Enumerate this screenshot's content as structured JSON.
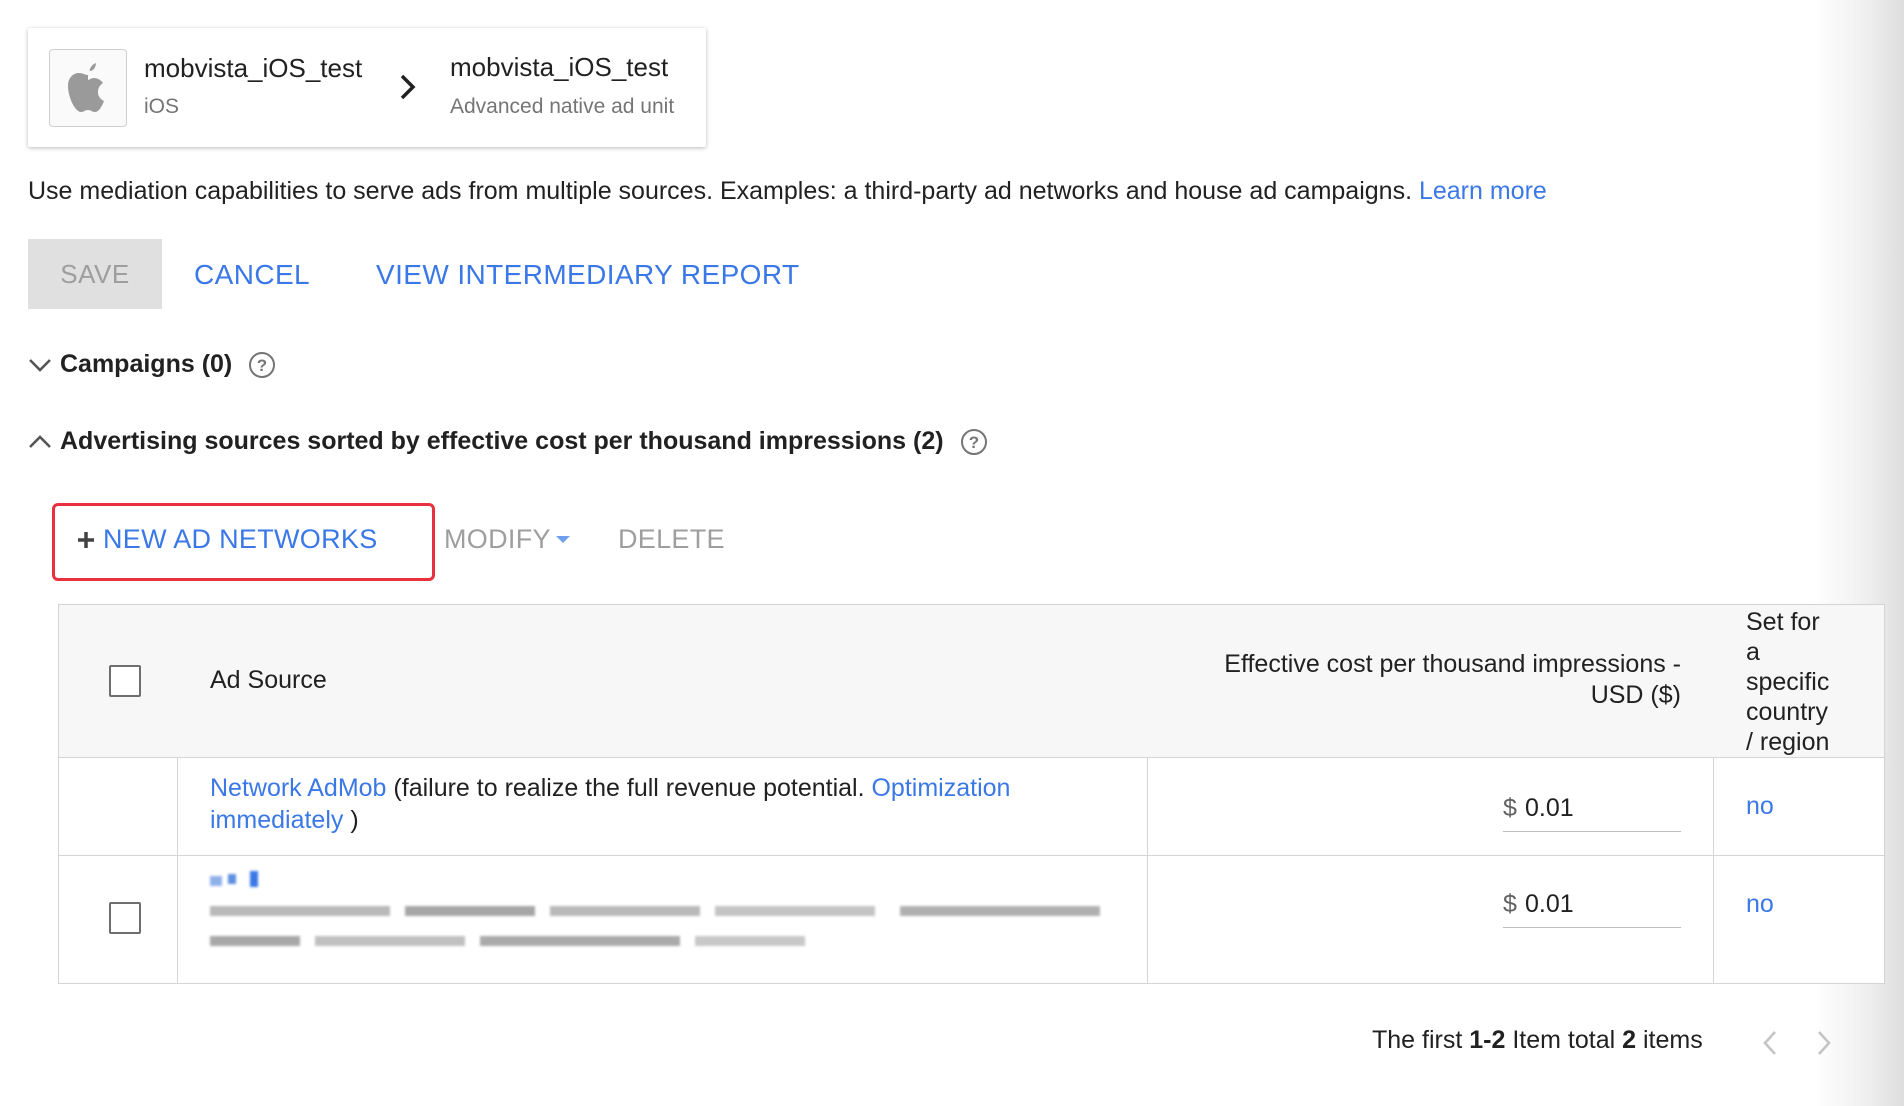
{
  "header": {
    "app_name": "mobvista_iOS_test",
    "platform": "iOS",
    "ad_unit_name": "mobvista_iOS_test",
    "ad_unit_type": "Advanced native ad unit"
  },
  "description": {
    "text": "Use mediation capabilities to serve ads from multiple sources. Examples: a third-party ad networks and house ad campaigns.",
    "learn_more": "Learn more"
  },
  "actions": {
    "save": "SAVE",
    "cancel": "CANCEL",
    "view_report": "VIEW INTERMEDIARY REPORT"
  },
  "sections": {
    "campaigns": "Campaigns (0)",
    "ad_sources": "Advertising sources sorted by effective cost per thousand impressions (2)"
  },
  "toolbar": {
    "new_ad_networks": "NEW AD NETWORKS",
    "modify": "MODIFY",
    "delete": "DELETE"
  },
  "table": {
    "columns": {
      "ad_source": "Ad Source",
      "ecpm_line1": "Effective cost per thousand impressions -",
      "ecpm_line2": "USD ($)",
      "country": [
        "Set for",
        "a",
        "specific",
        "country",
        "/ region"
      ]
    },
    "rows": [
      {
        "network_link": "Network AdMob",
        "note": "(failure to realize the full revenue potential.",
        "optimize_link_1": "Optimization",
        "optimize_link_2": "immediately",
        "close_paren": ")",
        "currency": "$",
        "ecpm": "0.01",
        "country": "no"
      },
      {
        "currency": "$",
        "ecpm": "0.01",
        "country": "no"
      }
    ]
  },
  "pagination": {
    "prefix": "The first",
    "range": "1-2",
    "middle": "Item total",
    "total": "2",
    "suffix": "items"
  },
  "colors": {
    "accent": "#3b78e7",
    "highlight_border": "#e8303f",
    "disabled": "#9e9e9e"
  }
}
